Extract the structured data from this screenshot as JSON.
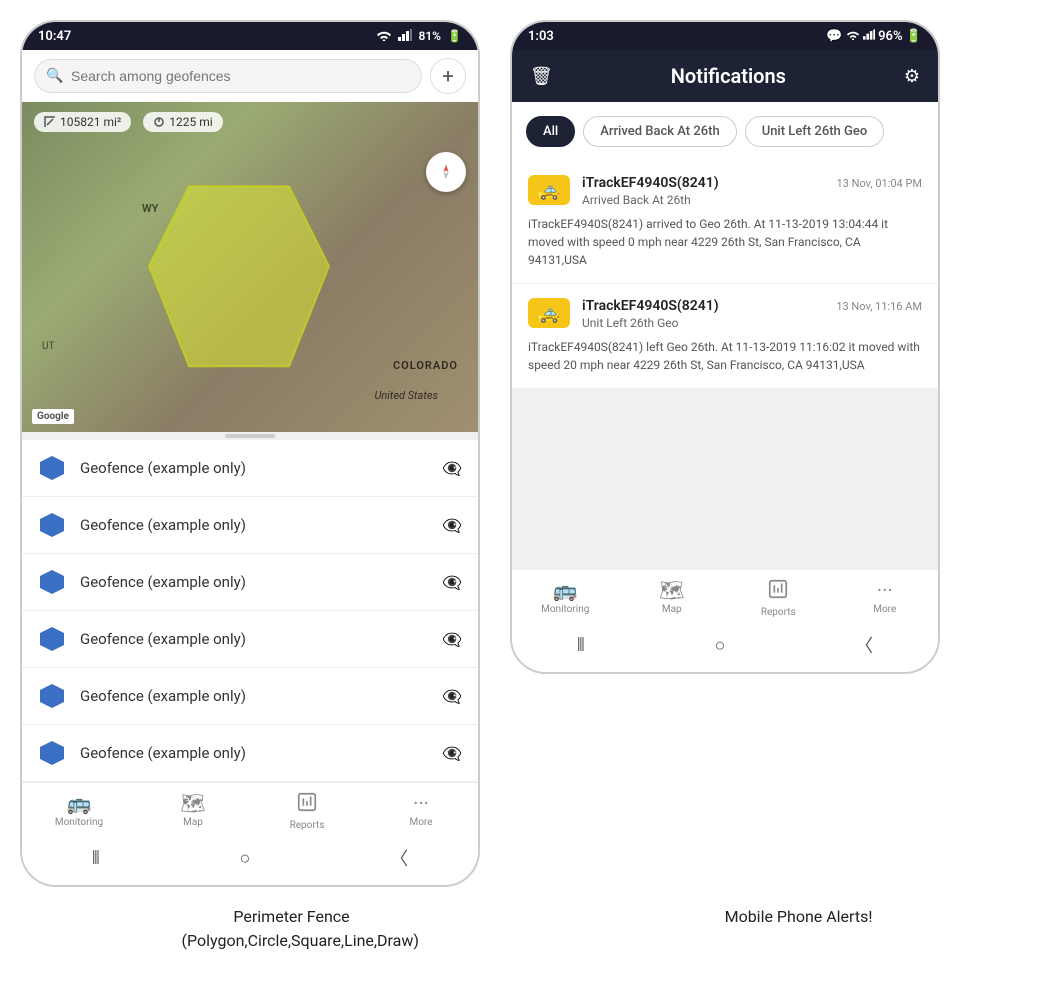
{
  "left_phone": {
    "status_bar": {
      "time": "10:47",
      "signal": "WiFi",
      "battery": "81%"
    },
    "search": {
      "placeholder": "Search among geofences",
      "add_button": "+"
    },
    "map": {
      "stat1": "105821 mi²",
      "stat2": "1225 mi",
      "state_wy": "WY",
      "state_ut": "UT",
      "state_co": "COLORADO",
      "country": "United States",
      "google_label": "Google"
    },
    "geofences": [
      {
        "label": "Geofence (example only)"
      },
      {
        "label": "Geofence (example only)"
      },
      {
        "label": "Geofence (example only)"
      },
      {
        "label": "Geofence (example only)"
      },
      {
        "label": "Geofence (example only)"
      },
      {
        "label": "Geofence (example only)"
      }
    ],
    "nav": [
      {
        "label": "Monitoring",
        "icon": "🚌"
      },
      {
        "label": "Map",
        "icon": "🗺"
      },
      {
        "label": "Reports",
        "icon": "📊"
      },
      {
        "label": "More",
        "icon": "···"
      }
    ],
    "caption": "Perimeter Fence\n(Polygon,Circle,Square,Line,Draw)"
  },
  "right_phone": {
    "status_bar": {
      "time": "1:03",
      "battery": "96%"
    },
    "header": {
      "title": "Notifications",
      "delete_icon": "delete",
      "settings_icon": "settings"
    },
    "filter_tabs": [
      {
        "label": "All",
        "active": true
      },
      {
        "label": "Arrived Back At 26th",
        "active": false
      },
      {
        "label": "Unit Left 26th Geo",
        "active": false
      }
    ],
    "notifications": [
      {
        "device": "iTrackEF4940S(8241)",
        "time": "13 Nov, 01:04 PM",
        "subtitle": "Arrived Back At 26th",
        "body": "iTrackEF4940S(8241) arrived to Geo 26th.   At 11-13-2019 13:04:44 it moved with speed 0 mph near 4229 26th St, San Francisco, CA 94131,USA"
      },
      {
        "device": "iTrackEF4940S(8241)",
        "time": "13 Nov, 11:16 AM",
        "subtitle": "Unit Left 26th Geo",
        "body": "iTrackEF4940S(8241) left Geo 26th.   At 11-13-2019 11:16:02 it moved with speed 20 mph near 4229 26th St, San Francisco, CA 94131,USA"
      }
    ],
    "nav": [
      {
        "label": "Monitoring",
        "icon": "🚌"
      },
      {
        "label": "Map",
        "icon": "🗺"
      },
      {
        "label": "Reports",
        "icon": "📊"
      },
      {
        "label": "More",
        "icon": "···"
      }
    ],
    "caption": "Mobile Phone Alerts!"
  }
}
